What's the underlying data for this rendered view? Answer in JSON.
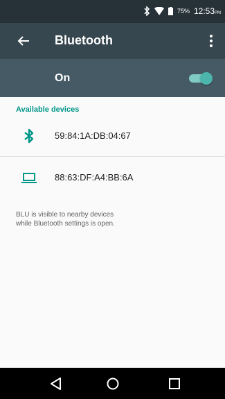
{
  "status_bar": {
    "icons": [
      "bluetooth-icon",
      "wifi-icon",
      "battery-icon"
    ],
    "battery": "75%",
    "time": "12:53",
    "ampm": "PM"
  },
  "toolbar": {
    "title": "Bluetooth",
    "back_icon": "arrow-left-icon",
    "menu_icon": "more-vert-icon"
  },
  "master_switch": {
    "label": "On",
    "state": true
  },
  "available": {
    "header": "Available devices",
    "devices": [
      {
        "name": "59:84:1A:DB:04:67",
        "icon": "bluetooth-icon"
      },
      {
        "name": "88:63:DF:A4:BB:6A",
        "icon": "laptop-icon"
      }
    ]
  },
  "note": "BLU  is visible to nearby devices\nwhile Bluetooth settings is open.",
  "nav": {
    "icons": [
      "back-triangle-icon",
      "home-circle-icon",
      "recents-square-icon"
    ]
  },
  "colors": {
    "accent": "#009688",
    "statusbar": "#263238",
    "toolbar": "#37474f",
    "switchbar": "#455a64"
  }
}
